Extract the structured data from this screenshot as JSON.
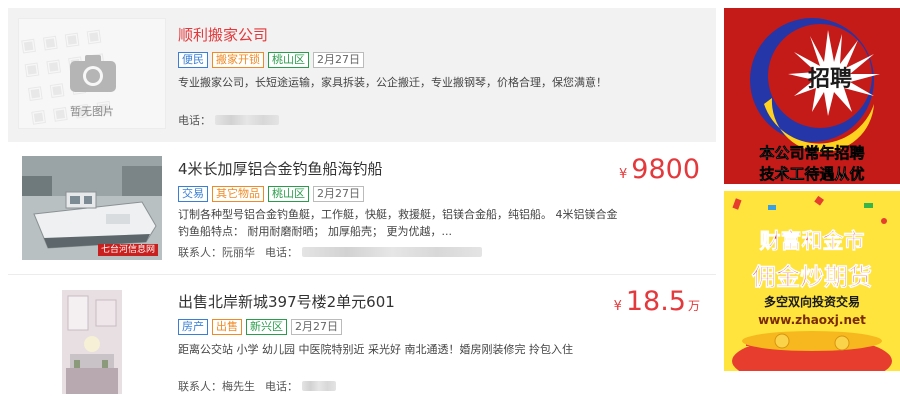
{
  "listings": [
    {
      "title": "顺利搬家公司",
      "tags": [
        {
          "text": "便民",
          "color": "blue"
        },
        {
          "text": "搬家开锁",
          "color": "orange"
        },
        {
          "text": "桃山区",
          "color": "green"
        },
        {
          "text": "2月27日",
          "color": "gray"
        }
      ],
      "image_caption": "暂无图片",
      "description": "专业搬家公司，长短途运输，家具拆装，公企搬迁，专业搬钢琴，价格合理，保您满意！",
      "phone_label": "电话："
    },
    {
      "title": "4米长加厚铝合金钓鱼船海钓船",
      "tags": [
        {
          "text": "交易",
          "color": "blue"
        },
        {
          "text": "其它物品",
          "color": "orange"
        },
        {
          "text": "桃山区",
          "color": "green"
        },
        {
          "text": "2月27日",
          "color": "gray"
        }
      ],
      "image_watermark": "七台河信息网",
      "description": "订制各种型号铝合金钓鱼艇，工作艇，快艇，救援艇，铝镁合金船，纯铝船。 4米铝镁合金钓鱼船特点： 耐用耐磨耐晒； 加厚船壳； 更为优越，...",
      "contact_label": "联系人：",
      "contact_name": "阮丽华",
      "phone_label": "电话：",
      "price_currency": "¥",
      "price": "9800",
      "price_unit": ""
    },
    {
      "title": "出售北岸新城397号楼2单元601",
      "tags": [
        {
          "text": "房产",
          "color": "blue"
        },
        {
          "text": "出售",
          "color": "orange"
        },
        {
          "text": "新兴区",
          "color": "green"
        },
        {
          "text": "2月27日",
          "color": "gray"
        }
      ],
      "description": "距离公交站 小学 幼儿园 中医院特别近 采光好 南北通透！婚房刚装修完 拎包入住",
      "contact_label": "联系人：",
      "contact_name": "梅先生",
      "phone_label": "电话：",
      "price_currency": "¥",
      "price": "18.5",
      "price_unit": "万"
    }
  ],
  "ads": [
    {
      "logo_text": "招聘",
      "line1": "本公司常年招聘",
      "line2": "技术工待遇从优"
    },
    {
      "line1": "财富和金市",
      "line2": "佣金炒期货",
      "line3": "多空双向投资交易",
      "url": "www.zhaoxj.net"
    }
  ],
  "colors": {
    "price_red": "#e4393c",
    "title_red": "#e4393c",
    "ad1_bg": "#c41a18",
    "ad2_bg": "#ffe43d"
  }
}
